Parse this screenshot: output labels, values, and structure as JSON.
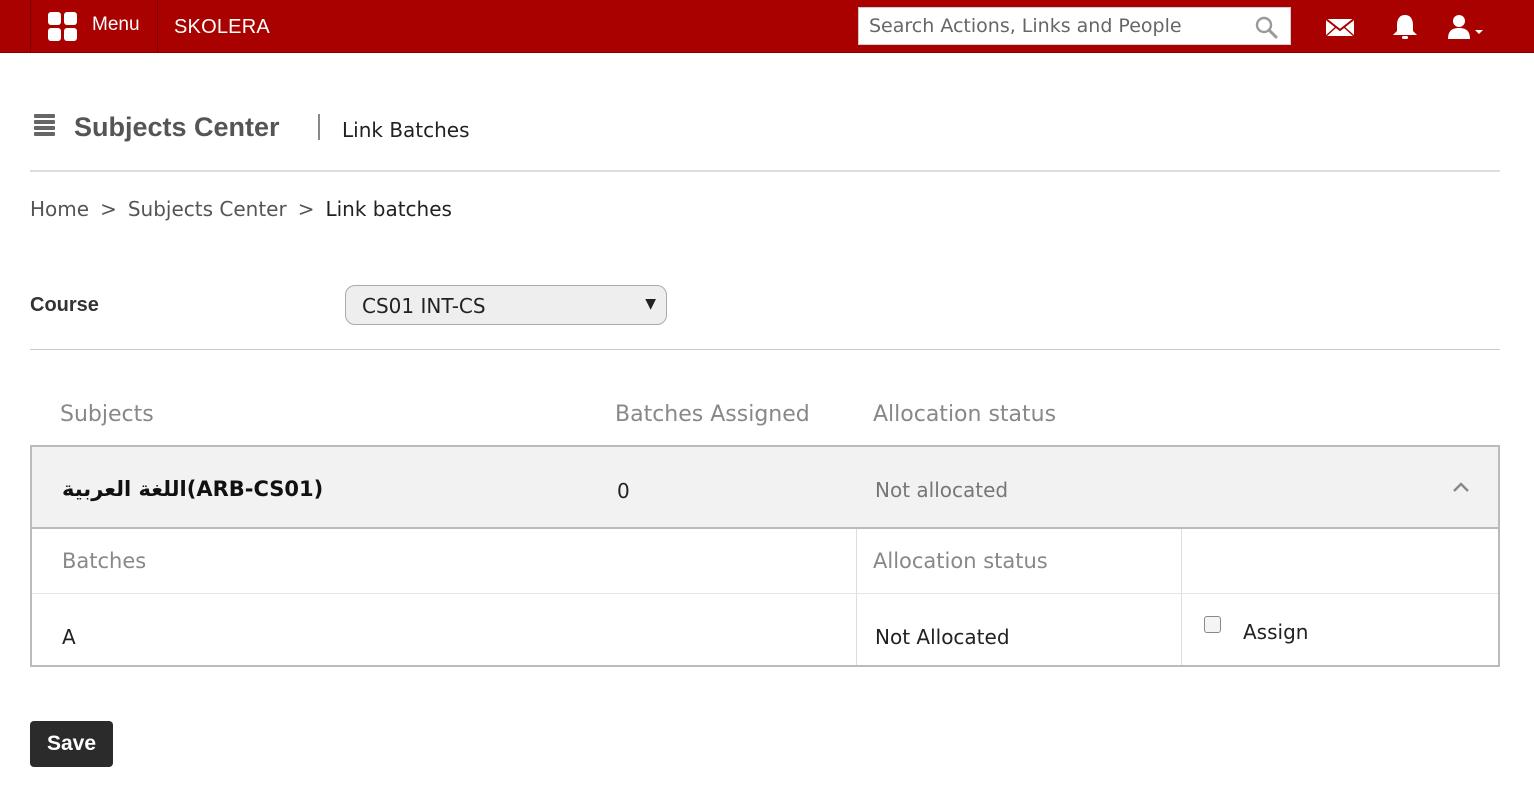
{
  "topbar": {
    "menu_label": "Menu",
    "brand": "SKOLERA",
    "search_placeholder": "Search Actions, Links and People",
    "bg_color": "#a90000"
  },
  "page": {
    "title": "Subjects Center",
    "subtitle": "Link Batches"
  },
  "breadcrumb": {
    "items": [
      "Home",
      "Subjects Center"
    ],
    "separator": ">",
    "current": "Link batches"
  },
  "course": {
    "label": "Course",
    "selected": "CS01 INT-CS"
  },
  "subjects_table": {
    "headers": [
      "Subjects",
      "Batches Assigned",
      "Allocation status"
    ],
    "rows": [
      {
        "subject": "اللغة العربية(ARB-CS01)",
        "batches_assigned": "0",
        "allocation_status": "Not allocated",
        "expanded": true,
        "batches": {
          "headers": [
            "Batches",
            "Allocation status",
            ""
          ],
          "rows": [
            {
              "batch": "A",
              "allocation_status": "Not Allocated",
              "assign_label": "Assign",
              "assigned": false
            }
          ]
        }
      }
    ]
  },
  "actions": {
    "save_label": "Save"
  },
  "icons": {
    "menu": "grid-icon",
    "search": "search-icon",
    "mail": "envelope-icon",
    "notifications": "bell-icon",
    "user": "user-icon",
    "page": "list-icon",
    "collapse": "chevron-up-icon"
  }
}
